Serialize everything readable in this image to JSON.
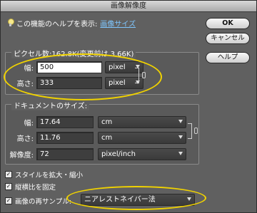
{
  "window": {
    "title": "画像解像度"
  },
  "help": {
    "prefix": "この機能のヘルプを表示:",
    "link": "画像サイズ"
  },
  "buttons": {
    "ok": "OK",
    "cancel": "キャンセル",
    "help": "ヘルプ"
  },
  "pixel_dims": {
    "legend": "ピクセル数:162.8K(変更前は 3.66K)",
    "width_label": "幅:",
    "width_value": "500",
    "width_unit": "pixel",
    "height_label": "高さ:",
    "height_value": "333",
    "height_unit": "pixel"
  },
  "doc_size": {
    "legend": "ドキュメントのサイズ:",
    "width_label": "幅:",
    "width_value": "17.64",
    "width_unit": "cm",
    "height_label": "高さ:",
    "height_value": "11.76",
    "height_unit": "cm",
    "resolution_label": "解像度:",
    "resolution_value": "72",
    "resolution_unit": "pixel/inch"
  },
  "options": {
    "scale_styles": "スタイルを拡大・縮小",
    "constrain": "縦横比を固定",
    "resample": "画像の再サンプル:",
    "resample_method": "ニアレストネイバー法"
  },
  "colors": {
    "highlight": "#f0d200",
    "link": "#7fc7ff"
  }
}
